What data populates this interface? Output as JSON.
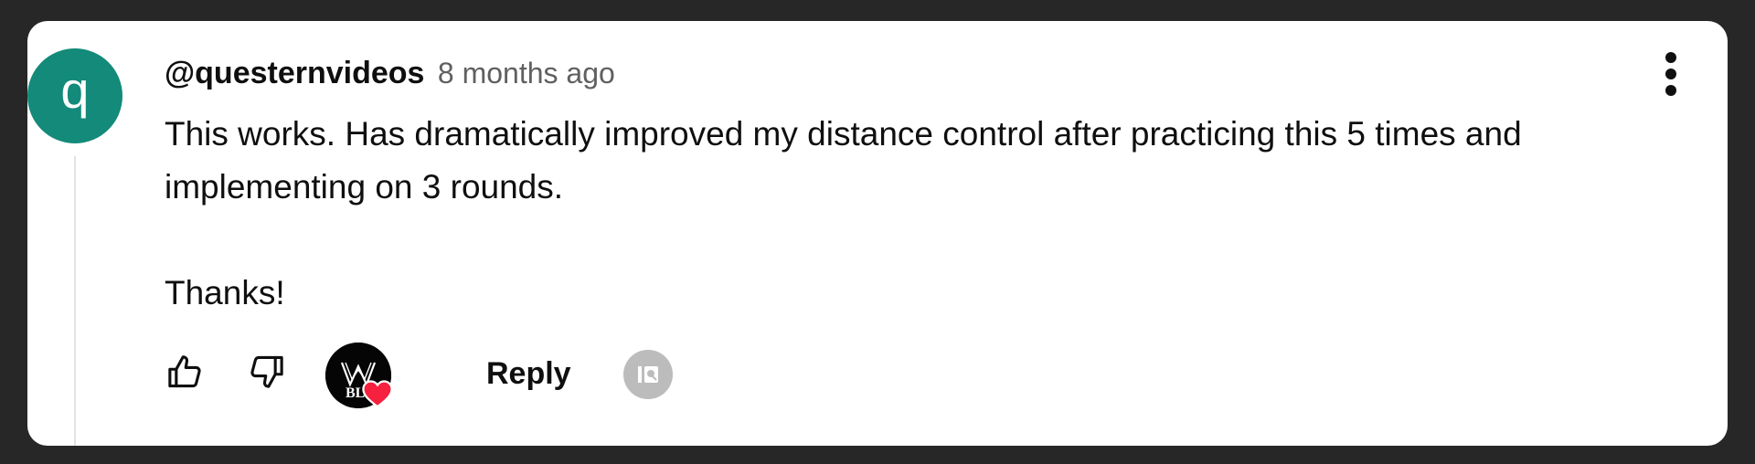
{
  "comment": {
    "avatar_letter": "q",
    "author": "@questernvideos",
    "time": "8 months ago",
    "body": {
      "paragraph1": "This works. Has dramatically improved my distance control after practicing this 5 times and implementing on 3 rounds.",
      "paragraph2": "Thanks!"
    }
  },
  "actions": {
    "reply_label": "Reply",
    "like_icon": "thumbs-up-icon",
    "dislike_icon": "thumbs-down-icon",
    "creator_heart_logo_text": "BL",
    "badge_icon": "pinned-badge-icon"
  },
  "colors": {
    "background": "#272727",
    "card": "#ffffff",
    "avatar": "#138a7a",
    "heart": "#f5213f",
    "text_secondary": "#606060"
  }
}
